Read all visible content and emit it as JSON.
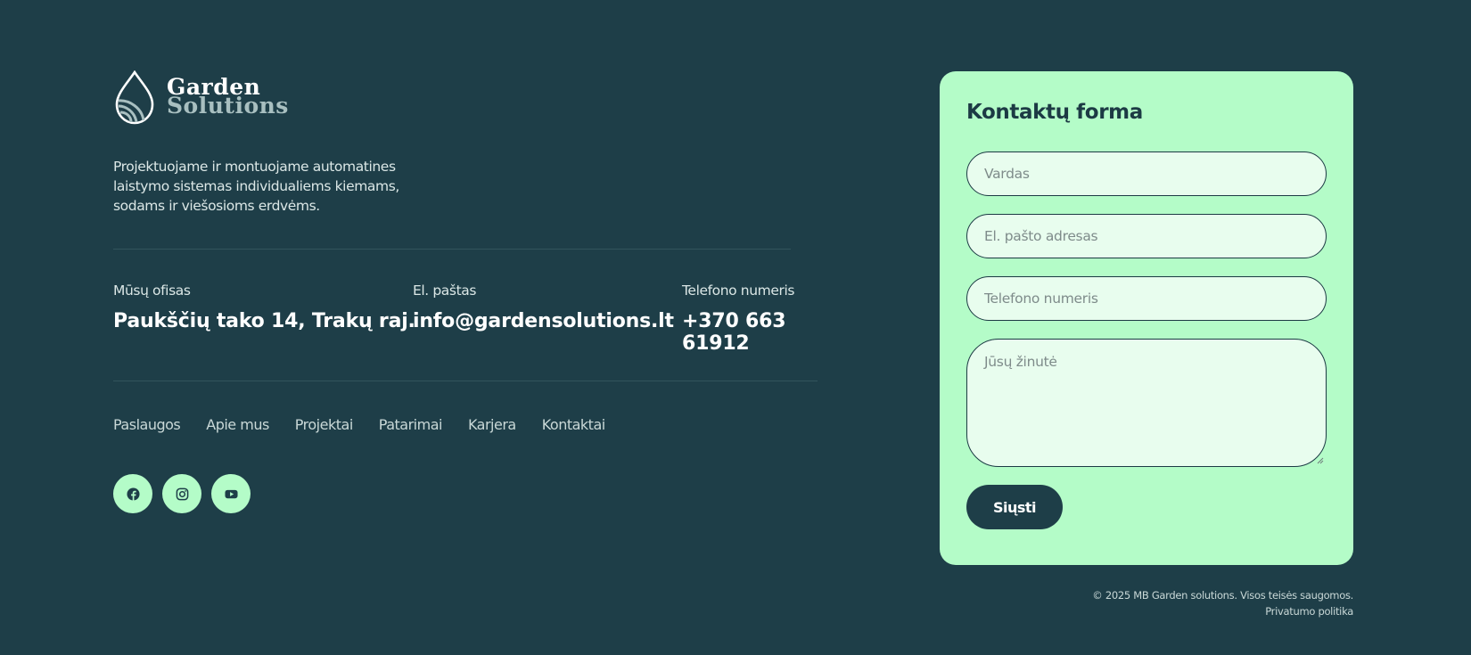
{
  "brand": {
    "line1": "Garden",
    "line2": "Solutions"
  },
  "description": "Projektuojame ir montuojame automatines laistymo sistemas individualiems kiemams, sodams ir viešosioms erdvėms.",
  "contacts": [
    {
      "label": "Mūsų ofisas",
      "value": "Paukščių tako 14, Trakų raj."
    },
    {
      "label": "El. paštas",
      "value": "info@gardensolutions.lt"
    },
    {
      "label": "Telefono numeris",
      "value": "+370 663 61912"
    }
  ],
  "nav": [
    "Paslaugos",
    "Apie mus",
    "Projektai",
    "Patarimai",
    "Karjera",
    "Kontaktai"
  ],
  "social": [
    "facebook-icon",
    "instagram-icon",
    "youtube-icon"
  ],
  "form": {
    "title": "Kontaktų forma",
    "name_placeholder": "Vardas",
    "email_placeholder": "El. pašto adresas",
    "phone_placeholder": "Telefono numeris",
    "message_placeholder": "Jūsų žinutė",
    "submit_label": "Siųsti"
  },
  "footer": {
    "copyright": "© 2025 MB Garden solutions. Visos teisės saugomos.",
    "privacy": "Privatumo politika"
  },
  "colors": {
    "background": "#1e3e48",
    "accent": "#b4fcc8",
    "field_bg": "#e8fdee",
    "text_dark": "#1c3a44"
  }
}
